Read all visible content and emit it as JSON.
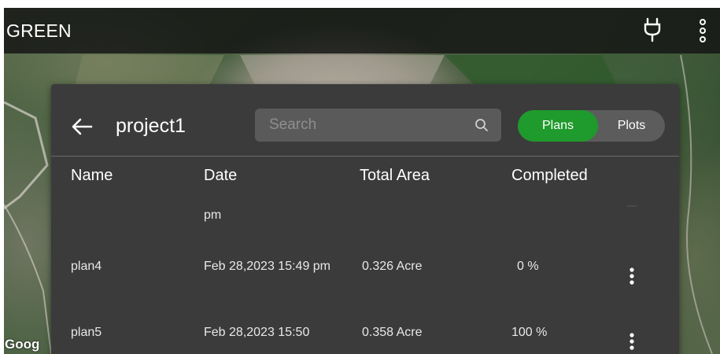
{
  "app_bar": {
    "title": "GREEN",
    "icons": [
      "plug-icon",
      "more-vertical-icon"
    ]
  },
  "map": {
    "attribution": "Goog"
  },
  "panel": {
    "back_icon": "arrow-left-icon",
    "project_name": "project1",
    "search": {
      "placeholder": "Search",
      "value": "",
      "icon": "search-icon"
    },
    "toggle": {
      "plans_label": "Plans",
      "plots_label": "Plots",
      "selected": "Plans"
    },
    "columns": {
      "name": "Name",
      "date": "Date",
      "total_area": "Total Area",
      "completed": "Completed"
    },
    "rows": [
      {
        "name": "",
        "date": "pm",
        "total_area": "",
        "completed": ""
      },
      {
        "name": "plan4",
        "date": "Feb 28,2023 15:49 pm",
        "total_area": "0.326 Acre",
        "completed": "0 %"
      },
      {
        "name": "plan5",
        "date": "Feb 28,2023 15:50",
        "total_area": "0.358 Acre",
        "completed": "100 %"
      }
    ]
  },
  "colors": {
    "accent_green": "#1f9a2c",
    "panel_bg": "#3b3b3b",
    "app_bar_bg": "#141414"
  }
}
